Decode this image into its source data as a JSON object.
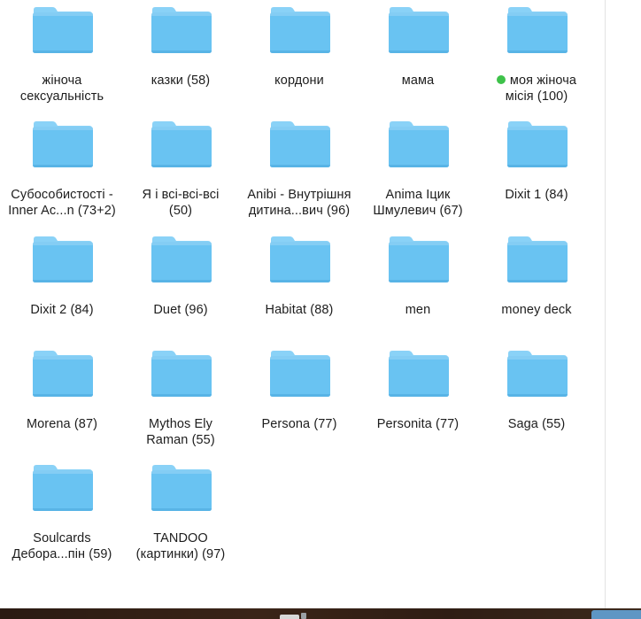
{
  "window": {
    "view_mode": "icon-view"
  },
  "colors": {
    "folder_main": "#69c3f2",
    "folder_tab": "#8ad2f7",
    "tag_green": "#3ec24a",
    "label_text": "#1d1d1d"
  },
  "folders": [
    {
      "label": "жіноча\nсексуальність",
      "tag": null
    },
    {
      "label": "казки (58)",
      "tag": null
    },
    {
      "label": "кордони",
      "tag": null
    },
    {
      "label": "мама",
      "tag": null
    },
    {
      "label": "моя жіноча\nмісія (100)",
      "tag": "green"
    },
    {
      "label": "Субособистості -\nInner Ac...n (73+2)",
      "tag": null
    },
    {
      "label": "Я і всі-всі-всі\n(50)",
      "tag": null
    },
    {
      "label": "Anibi - Внутрішня\nдитина...вич (96)",
      "tag": null
    },
    {
      "label": "Anima Іцик\nШмулевич (67)",
      "tag": null
    },
    {
      "label": "Dixit 1 (84)",
      "tag": null
    },
    {
      "label": "Dixit 2 (84)",
      "tag": null
    },
    {
      "label": "Duet (96)",
      "tag": null
    },
    {
      "label": "Habitat (88)",
      "tag": null
    },
    {
      "label": "men",
      "tag": null
    },
    {
      "label": "money deck",
      "tag": null
    },
    {
      "label": "Morena (87)",
      "tag": null
    },
    {
      "label": "Mythos Ely\nRaman (55)",
      "tag": null
    },
    {
      "label": "Persona (77)",
      "tag": null
    },
    {
      "label": "Personita (77)",
      "tag": null
    },
    {
      "label": "Saga (55)",
      "tag": null
    },
    {
      "label": "Soulcards\nДебора...пін (59)",
      "tag": null
    },
    {
      "label": "TANDOO\n(картинки) (97)",
      "tag": null
    }
  ]
}
